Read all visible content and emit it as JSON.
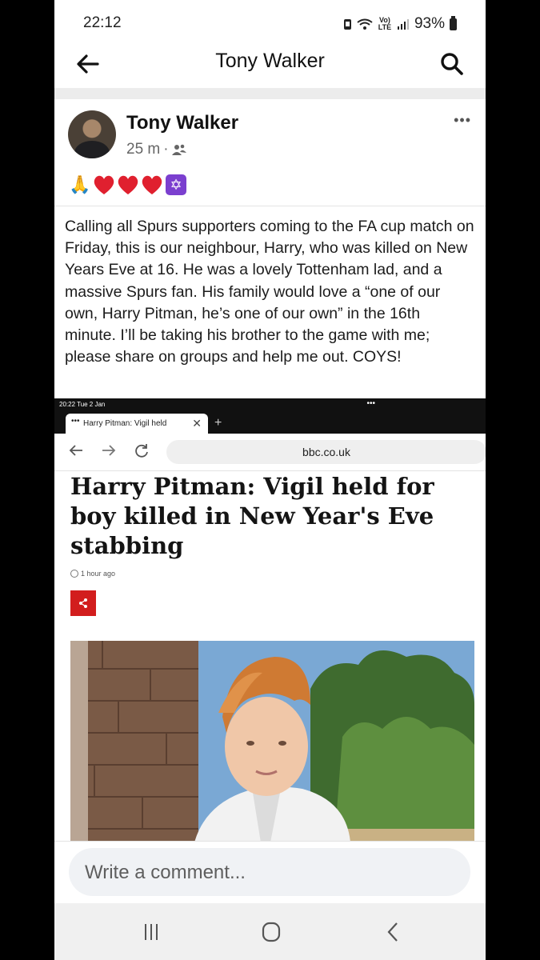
{
  "status_bar": {
    "time": "22:12",
    "network": "Vo) LTE",
    "battery": "93%"
  },
  "header": {
    "title": "Tony Walker",
    "back_icon": "arrow-left-icon",
    "search_icon": "search-icon"
  },
  "post": {
    "author": "Tony Walker",
    "time": "25 m",
    "separator": "·",
    "audience_icon": "friends-icon",
    "emojis": [
      "🙏",
      "❤️",
      "❤️",
      "❤️",
      "✡"
    ],
    "text": "Calling all Spurs supporters coming to the FA cup match on Friday, this is our neighbour, Harry, who was killed on New Years Eve at 16. He was a lovely Tottenham lad, and a massive Spurs fan. His family would love a “one of our own, Harry Pitman, he’s one of our own” in the 16th minute. I’ll be taking his brother to the game with me; please share on groups and help me out. COYS!",
    "more_label": "•••"
  },
  "embedded": {
    "status_time": "20:22  Tue 2 Jan",
    "status_dots": "•••",
    "tab_label": "Harry Pitman: Vigil held",
    "tab_dots": "•••",
    "tab_close": "✕",
    "tab_plus": "+",
    "url": "bbc.co.uk",
    "headline": "Harry Pitman: Vigil held for boy killed in New Year's Eve stabbing",
    "time_ago": "1 hour ago"
  },
  "comment": {
    "placeholder": "Write a comment..."
  },
  "colors": {
    "share_red": "#d21d1d",
    "avatar_bg": "#4a4036",
    "heart_red": "#e0202f"
  }
}
